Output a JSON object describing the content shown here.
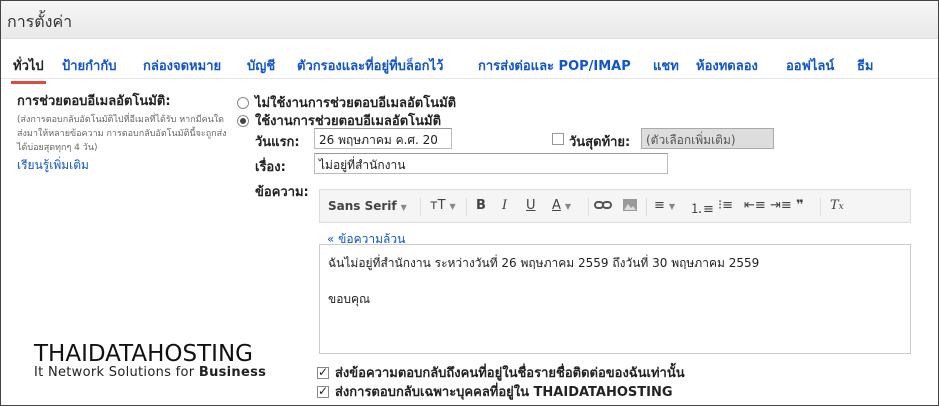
{
  "window": {
    "title": "การตั้งค่า"
  },
  "tabs": [
    {
      "label": "ทั่วไป",
      "active": true
    },
    {
      "label": "ป้ายกำกับ"
    },
    {
      "label": "กล่องจดหมาย"
    },
    {
      "label": "บัญชี"
    },
    {
      "label": "ตัวกรองและที่อยู่ที่บล็อกไว้"
    },
    {
      "label": "การส่งต่อและ POP/IMAP"
    },
    {
      "label": "แชท"
    },
    {
      "label": "ห้องทดลอง"
    },
    {
      "label": "ออฟไลน์"
    },
    {
      "label": "ธีม"
    }
  ],
  "vacation": {
    "heading": "การช่วยตอบอีเมลอัตโนมัติ:",
    "help_text": "(ส่งการตอบกลับอัตโนมัติไปที่อีเมลที่ได้รับ หากมีคนใดส่งมาให้หลายข้อความ การตอบกลับอัตโนมัตินี้จะถูกส่งได้บ่อยสุดทุกๆ 4 วัน)",
    "learn_more": "เรียนรู้เพิ่มเติม",
    "off_label": "ไม่ใช้งานการช่วยตอบอีเมลอัตโนมัติ",
    "on_label": "ใช้งานการช่วยตอบอีเมลอัตโนมัติ",
    "first_day_label": "วันแรก:",
    "first_day_value": "26 พฤษภาคม ค.ศ. 20",
    "last_day_label": "วันสุดท้าย:",
    "last_day_placeholder": "(ตัวเลือกเพิ่มเติม)",
    "subject_label": "เรื่อง:",
    "subject_value": "ไม่อยู่ที่สำนักงาน",
    "message_label": "ข้อความ:",
    "plain_text_link": "« ข้อความล้วน",
    "message_line1": "ฉันไม่อยู่ที่สำนักงาน ระหว่างวันที่ 26 พฤษภาคม 2559 ถึงวันที่ 30 พฤษภาคม 2559",
    "message_line2": "ขอบคุณ",
    "contacts_only": "ส่งข้อความตอบกลับถึงคนที่อยู่ในชื่อรายชื่อติดต่อของฉันเท่านั้น",
    "domain_only": "ส่งการตอบกลับเฉพาะบุคคลที่อยู่ใน THAIDATAHOSTING"
  },
  "toolbar": {
    "font": "Sans Serif"
  },
  "logo": {
    "main": "THAIDATAHOSTING",
    "sub_prefix": "It Network Solutions for ",
    "sub_bold": "Business"
  }
}
